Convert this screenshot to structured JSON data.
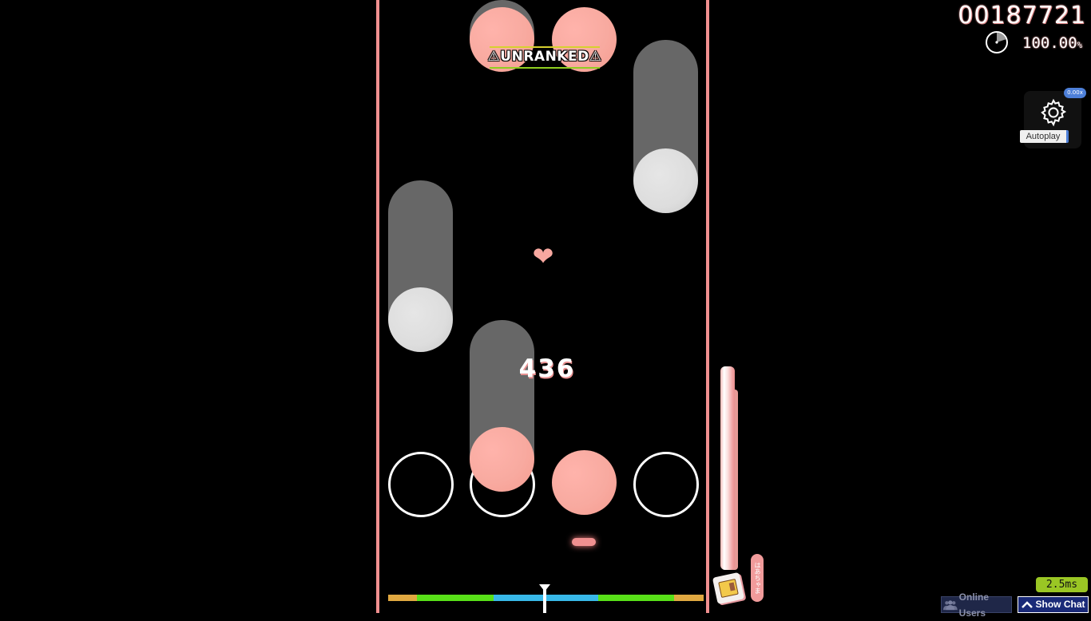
{
  "hud": {
    "score": "00187721",
    "accuracy": "100.00",
    "accuracy_unit": "%",
    "accuracy_progress_fraction": 0.2,
    "combo": "436",
    "unranked_label": "⚠UNRANKED⚠",
    "health_fraction": 1.0
  },
  "mods": {
    "badge": "0.00x",
    "label": "Autoplay",
    "icon": "gear-icon"
  },
  "footer": {
    "latency": "2.5ms",
    "online_users_label": "Online Users",
    "show_chat_label": "Show Chat"
  },
  "health_tag": "はあちゃま",
  "colors": {
    "playfield_border": "#f09090",
    "note_pink": "#f8aaa0",
    "note_white": "#dddddd",
    "hold_body": "#676767",
    "hit_meet_x": "#e0a840",
    "hit_good": "#58e018",
    "hit_great": "#38b8e8",
    "latency_badge": "#9ac624",
    "mod_badge": "#4d7fd8"
  },
  "hit_error_meter": {
    "segments": [
      "meh",
      "good",
      "great",
      "great",
      "good",
      "meh"
    ]
  }
}
